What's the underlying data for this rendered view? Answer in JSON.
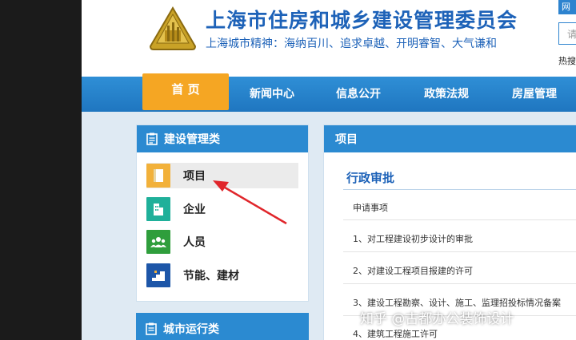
{
  "header": {
    "title": "上海市住房和城乡建设管理委员会",
    "motto": "上海城市精神：海纳百川、追求卓越、开明睿智、大气谦和",
    "emblem_icon": "city-emblem-icon",
    "search_tab": "网",
    "search_placeholder": "请",
    "hot_search": "热搜"
  },
  "nav": {
    "home": "首 页",
    "items": [
      "新闻中心",
      "信息公开",
      "政策法规",
      "房屋管理"
    ]
  },
  "left_panel": {
    "title": "建设管理类",
    "items": [
      {
        "label": "项目",
        "icon": "book-icon",
        "color": "#f2b13a"
      },
      {
        "label": "企业",
        "icon": "building-icon",
        "color": "#1fb09a"
      },
      {
        "label": "人员",
        "icon": "people-icon",
        "color": "#2f9e3c"
      },
      {
        "label": "节能、建材",
        "icon": "stairs-icon",
        "color": "#1d56a8"
      }
    ]
  },
  "left_panel2": {
    "title": "城市运行类"
  },
  "right_panel": {
    "title": "项目",
    "section": "行政审批",
    "rows": [
      "申请事项",
      "1、对工程建设初步设计的审批",
      "2、对建设工程项目报建的许可",
      "3、建设工程勘察、设计、施工、监理招投标情况备案",
      "4、建筑工程施工许可"
    ]
  },
  "watermark": "知乎 @古都办公装饰设计",
  "colors": {
    "accent": "#2b8ad1",
    "home_tab": "#f5a623",
    "arrow": "#e0262b"
  }
}
